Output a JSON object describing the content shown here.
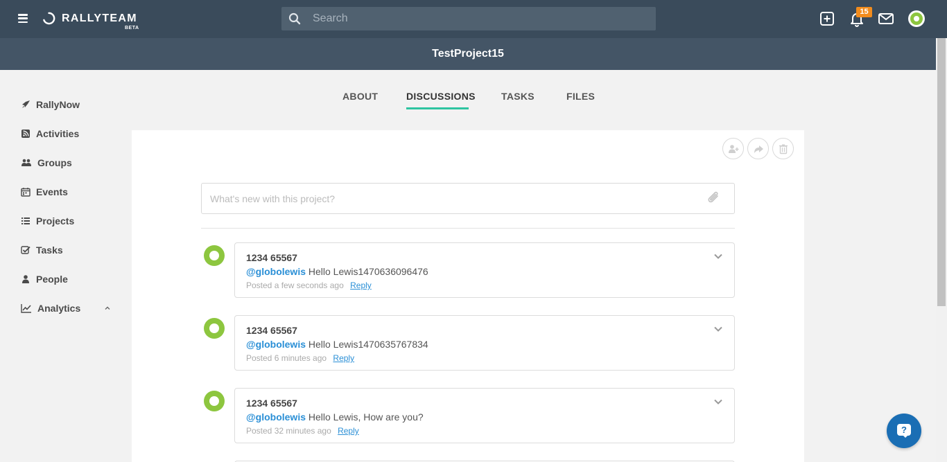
{
  "brand": {
    "name": "RALLYTEAM",
    "tag": "BETA"
  },
  "search": {
    "placeholder": "Search"
  },
  "notifications": {
    "count": "15"
  },
  "project": {
    "title": "TestProject15"
  },
  "sidebar": {
    "items": [
      {
        "label": "RallyNow",
        "icon": "rocket-icon"
      },
      {
        "label": "Activities",
        "icon": "rss-icon"
      },
      {
        "label": "Groups",
        "icon": "users-icon"
      },
      {
        "label": "Events",
        "icon": "calendar-icon"
      },
      {
        "label": "Projects",
        "icon": "list-icon"
      },
      {
        "label": "Tasks",
        "icon": "checkbox-icon"
      },
      {
        "label": "People",
        "icon": "user-icon"
      },
      {
        "label": "Analytics",
        "icon": "line-chart-icon"
      }
    ]
  },
  "tabs": [
    {
      "label": "ABOUT"
    },
    {
      "label": "DISCUSSIONS",
      "active": true
    },
    {
      "label": "TASKS"
    },
    {
      "label": "FILES"
    }
  ],
  "composer": {
    "placeholder": "What's new with this project?"
  },
  "posts": [
    {
      "author": "1234 65567",
      "mention": "@globolewis",
      "text": "Hello Lewis1470636096476",
      "time": "Posted a few seconds ago",
      "reply": "Reply"
    },
    {
      "author": "1234 65567",
      "mention": "@globolewis",
      "text": "Hello Lewis1470635767834",
      "time": "Posted 6 minutes ago",
      "reply": "Reply"
    },
    {
      "author": "1234 65567",
      "mention": "@globolewis",
      "text": "Hello Lewis, How are you?",
      "time": "Posted 32 minutes ago",
      "reply": "Reply"
    }
  ],
  "help": {
    "label": "?"
  },
  "colors": {
    "topbar": "#3a4b5b",
    "project_bar": "#445566",
    "accent": "#2ec4a1",
    "link": "#2a8fd6",
    "avatar": "#8dc63f",
    "badge": "#f28c1d",
    "help": "#1a6eb4"
  }
}
